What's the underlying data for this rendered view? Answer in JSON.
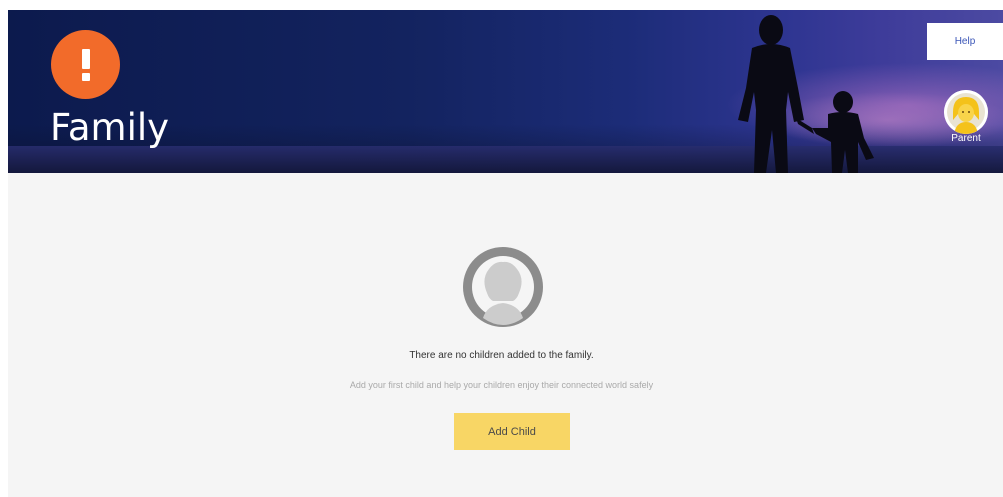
{
  "header": {
    "title": "Family",
    "help_label": "Help",
    "parent_label": "Parent",
    "alert_icon": "exclamation-icon",
    "colors": {
      "alert": "#f26b2a",
      "banner": "#13235f"
    }
  },
  "empty_state": {
    "title": "There are no children added to the family.",
    "subtitle": "Add your first child and help your children enjoy their connected world safely",
    "button_label": "Add Child",
    "icon": "child-avatar-icon",
    "colors": {
      "button": "#f8d665"
    }
  }
}
